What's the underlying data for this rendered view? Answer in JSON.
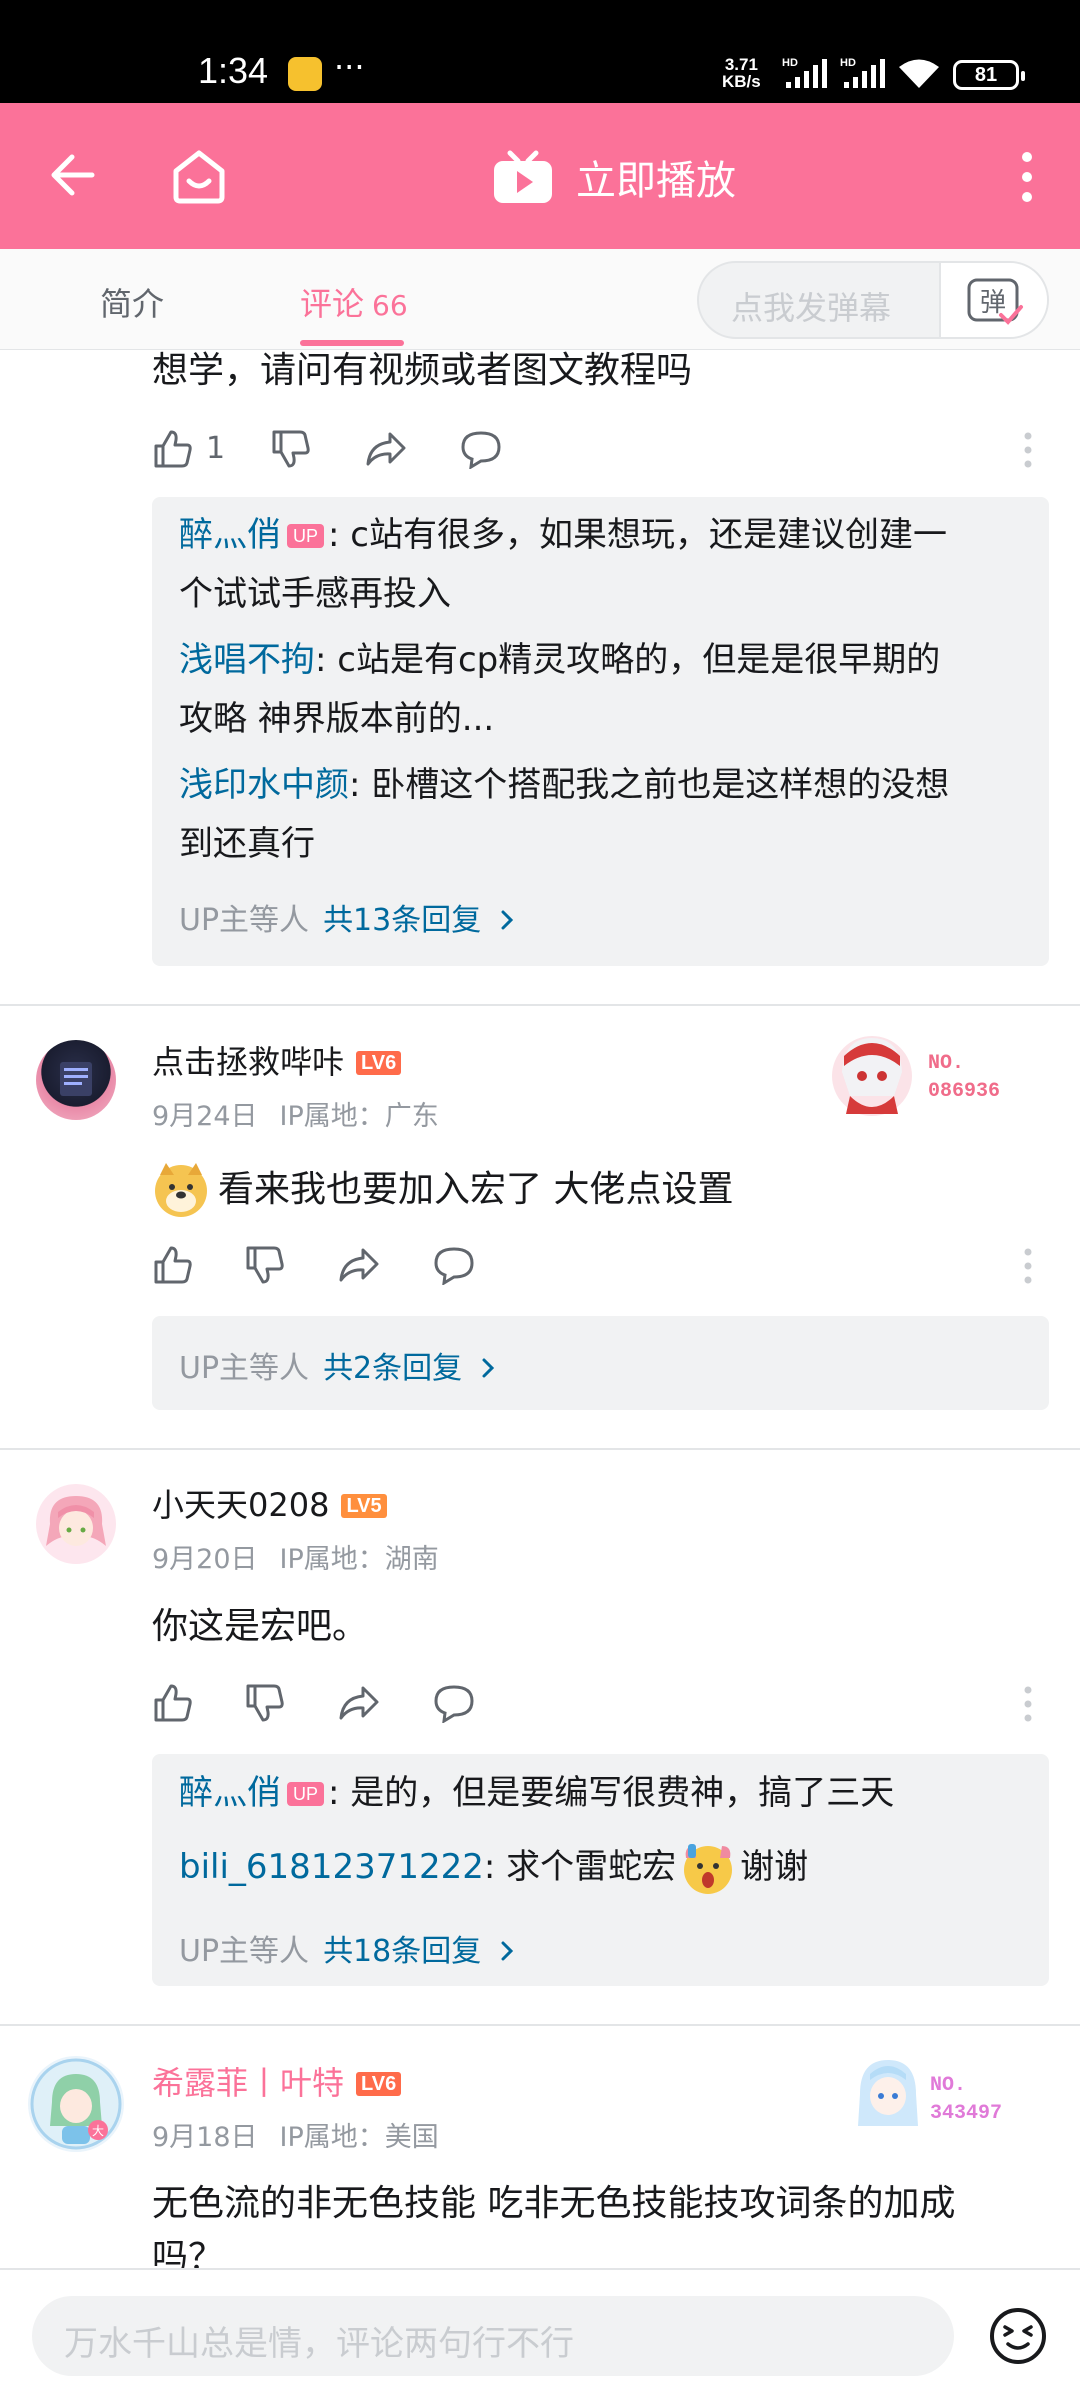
{
  "status_bar": {
    "time": "1:34",
    "more": "···",
    "network_speed_value": "3.71",
    "network_speed_unit": "KB/s",
    "signal_1": "HD",
    "signal_2": "HD",
    "battery": "81"
  },
  "header": {
    "back_icon": "arrow-left-icon",
    "home_icon": "home-icon",
    "play_icon": "tv-play-icon",
    "play_label": "立即播放",
    "more_icon": "more-vertical-icon",
    "background_color": "#fb7299"
  },
  "tabs": {
    "intro": "简介",
    "comments": "评论",
    "comments_count": "66",
    "danmaku_placeholder": "点我发弹幕",
    "danmaku_button": "弹"
  },
  "comments": [
    {
      "text": "想学，请问有视频或者图文教程吗",
      "likes": "1",
      "replies": [
        {
          "name": "醉灬俏",
          "is_up": true,
          "up_badge": "UP",
          "text": ": c站有很多，如果想玩，还是建议创建一",
          "text2": "个试试手感再投入"
        },
        {
          "name": "浅唱不拘",
          "is_up": false,
          "text": ": c站是有cp精灵攻略的，但是是很早期的",
          "text2": "攻略 神界版本前的..."
        },
        {
          "name": "浅印水中颜",
          "is_up": false,
          "text": ": 卧槽这个搭配我之前也是这样想的没想",
          "text2": "到还真行"
        }
      ],
      "reply_footer": {
        "prefix": "UP主等人",
        "link": "共13条回复"
      }
    },
    {
      "user": "点击拯救哔咔",
      "level": "LV6",
      "date": "9月24日",
      "ip": "IP属地：广东",
      "emoji": "doge-emoji",
      "text": "看来我也要加入宏了  大佬点设置",
      "fan_badge_label": "NO.",
      "fan_badge_number": "086936",
      "reply_footer": {
        "prefix": "UP主等人",
        "link": "共2条回复"
      }
    },
    {
      "user": "小天天0208",
      "level": "LV5",
      "date": "9月20日",
      "ip": "IP属地：湖南",
      "text": "你这是宏吧。",
      "replies": [
        {
          "name": "醉灬俏",
          "is_up": true,
          "up_badge": "UP",
          "text": ": 是的，但是要编写很费神，搞了三天"
        },
        {
          "name": "bili_61812371222",
          "is_up": false,
          "text": ": 求个雷蛇宏",
          "text_after_emoji": "谢谢",
          "emoji": "shock-emoji"
        }
      ],
      "reply_footer": {
        "prefix": "UP主等人",
        "link": "共18条回复"
      }
    },
    {
      "user": "希露菲丨叶特",
      "level": "LV6",
      "date": "9月18日",
      "ip": "IP属地：美国",
      "text": "无色流的非无色技能 吃非无色技能技攻词条的加成",
      "text2": "吗？",
      "fan_badge_label": "NO.",
      "fan_badge_number": "343497"
    }
  ],
  "bottom_bar": {
    "placeholder": "万水千山总是情，评论两句行不行",
    "emoji_icon": "emoji-icon"
  },
  "colors": {
    "accent": "#fb7299",
    "link": "#00699d",
    "level6": "#ff6b4a",
    "level5": "#ff8f3d"
  }
}
